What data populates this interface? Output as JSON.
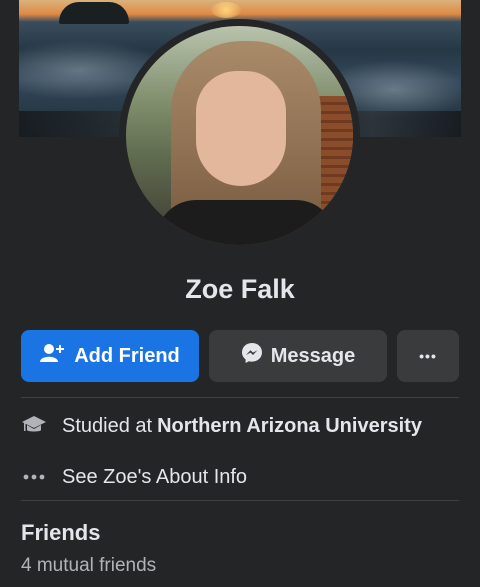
{
  "profile": {
    "name": "Zoe Falk"
  },
  "actions": {
    "add_friend_label": "Add Friend",
    "message_label": "Message",
    "more_label": "•••"
  },
  "about": {
    "education_prefix": "Studied at",
    "education_school": "Northern Arizona University",
    "see_about_label": "See Zoe's About Info"
  },
  "friends": {
    "title": "Friends",
    "mutual": "4 mutual friends"
  },
  "colors": {
    "background": "#242526",
    "primary_button": "#1b74e4",
    "secondary_button": "#3a3b3c",
    "text_primary": "#e4e6eb",
    "text_secondary": "#b0b3b8"
  },
  "icons": [
    "add-friend-icon",
    "messenger-icon",
    "more-icon",
    "graduation-cap-icon",
    "ellipsis-icon"
  ]
}
